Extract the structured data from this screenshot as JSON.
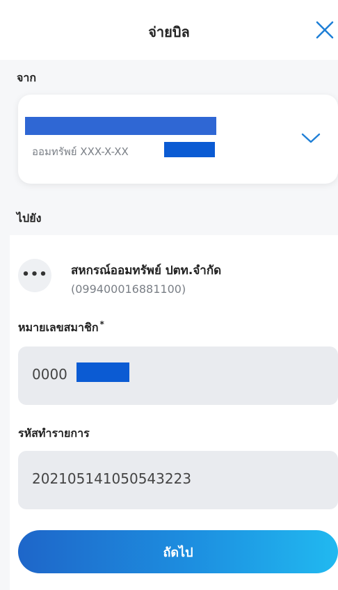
{
  "header": {
    "title": "จ่ายบิล"
  },
  "from": {
    "label": "จาก",
    "account_text": "ออมทรัพย์ XXX-X-XX"
  },
  "to": {
    "label": "ไปยัง",
    "payee_name": "สหกรณ์ออมทรัพย์ ปตท.จำกัด",
    "payee_id": "(099400016881100)",
    "payee_icon_text": "•••"
  },
  "fields": {
    "member_number": {
      "label": "หมายเลขสมาชิก",
      "required_mark": "*",
      "value": "0000"
    },
    "transaction_code": {
      "label": "รหัสทำรายการ",
      "value": "202105141050543223"
    }
  },
  "actions": {
    "next_label": "ถัดไป"
  },
  "colors": {
    "accent": "#1d8fe0",
    "mask": "#0b5bd3",
    "field_bg": "#e9ebef"
  }
}
